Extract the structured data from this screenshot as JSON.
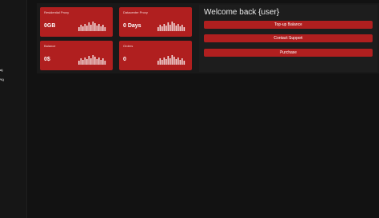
{
  "sidebar": {
    "items": [
      {
        "label": "a)"
      },
      {
        "label": "%)"
      }
    ]
  },
  "cards": [
    {
      "title": "Residential Proxy",
      "value": "0GB"
    },
    {
      "title": "Datacenter Proxy",
      "value": "0 Days"
    },
    {
      "title": "Balance",
      "value": "0$"
    },
    {
      "title": "Orders",
      "value": "0"
    }
  ],
  "welcome": {
    "title": "Welcome back {user}",
    "buttons": [
      {
        "label": "Top-up Balance"
      },
      {
        "label": "Contact Support"
      },
      {
        "label": "Purchase"
      }
    ]
  },
  "colors": {
    "accent": "#b01f1f",
    "background": "#121212",
    "panel": "#1d1d1d"
  }
}
